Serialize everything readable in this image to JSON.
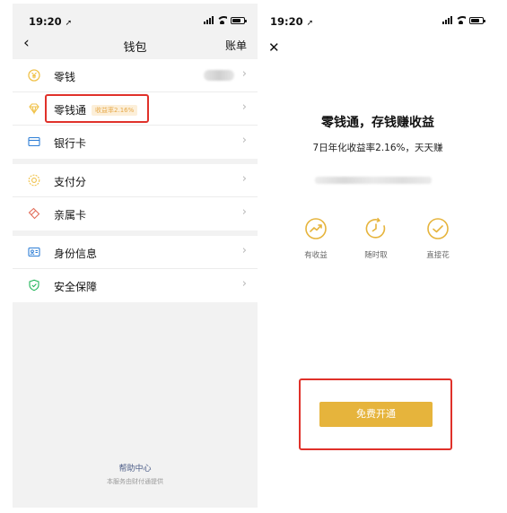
{
  "left": {
    "status": {
      "time": "19:20"
    },
    "nav": {
      "back_icon": "chevron-left-icon",
      "title": "钱包",
      "right_label": "账单"
    },
    "groups": [
      [
        {
          "label": "零钱",
          "icon": "yen-coin-icon",
          "icon_color": "#f0c24b"
        },
        {
          "label": "零钱通",
          "badge": "收益率2.16%",
          "icon": "diamond-icon",
          "icon_color": "#f0c24b",
          "highlighted": true
        },
        {
          "label": "银行卡",
          "icon": "card-icon",
          "icon_color": "#2f7fd6"
        }
      ],
      [
        {
          "label": "支付分",
          "icon": "score-icon",
          "icon_color": "#f0c24b"
        },
        {
          "label": "亲属卡",
          "icon": "family-card-icon",
          "icon_color": "#e26d5a"
        }
      ],
      [
        {
          "label": "身份信息",
          "icon": "id-card-icon",
          "icon_color": "#2f7fd6"
        },
        {
          "label": "安全保障",
          "icon": "shield-icon",
          "icon_color": "#21b559"
        }
      ]
    ],
    "footer": {
      "help": "帮助中心",
      "note": "本服务由财付通提供"
    }
  },
  "right": {
    "status": {
      "time": "19:20"
    },
    "close_icon": "close-icon",
    "title": "零钱通，存钱赚收益",
    "subtitle": "7日年化收益率2.16%，天天赚",
    "features": [
      {
        "label": "有收益",
        "icon": "trend-up-icon"
      },
      {
        "label": "随时取",
        "icon": "refresh-clock-icon"
      },
      {
        "label": "直接花",
        "icon": "check-circle-icon"
      }
    ],
    "cta": "免费开通"
  },
  "colors": {
    "accent": "#e6b43c",
    "highlight": "#e0312a",
    "link": "#4a5b86"
  }
}
